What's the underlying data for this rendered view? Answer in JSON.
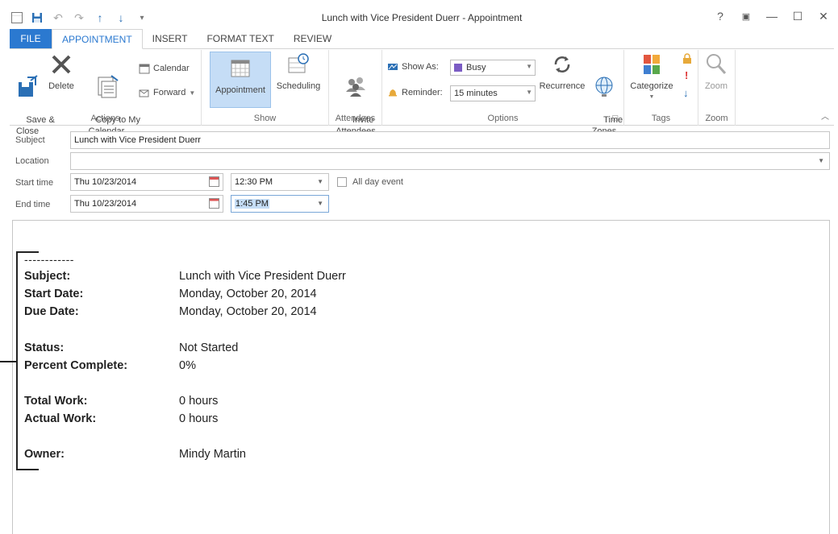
{
  "window": {
    "title": "Lunch with Vice President Duerr - Appointment",
    "help": "?",
    "ribbon_options": "▣",
    "minimize": "—",
    "maximize": "☐",
    "close": "✕"
  },
  "qat": {
    "app_icon": "calendar-icon",
    "save": "save-icon",
    "undo": "undo-icon",
    "redo": "redo-icon",
    "up": "↑",
    "down": "↓",
    "more": "▾"
  },
  "tabs": [
    "FILE",
    "APPOINTMENT",
    "INSERT",
    "FORMAT TEXT",
    "REVIEW"
  ],
  "ribbon": {
    "actions": {
      "label": "Actions",
      "save_close": "Save &\nClose",
      "delete": "Delete",
      "copy_to_calendar": "Copy to My\nCalendar",
      "calendar": "Calendar",
      "forward": "Forward"
    },
    "show": {
      "label": "Show",
      "appointment": "Appointment",
      "scheduling": "Scheduling"
    },
    "attendees": {
      "label": "Attendees",
      "invite": "Invite\nAttendees"
    },
    "options": {
      "label": "Options",
      "show_as_label": "Show As:",
      "show_as_value": "Busy",
      "reminder_label": "Reminder:",
      "reminder_value": "15 minutes",
      "recurrence": "Recurrence",
      "time_zones": "Time\nZones"
    },
    "tags": {
      "label": "Tags",
      "categorize": "Categorize"
    },
    "zoom": {
      "label": "Zoom",
      "zoom": "Zoom"
    }
  },
  "form": {
    "subject_label": "Subject",
    "subject_value": "Lunch with Vice President Duerr",
    "location_label": "Location",
    "location_value": "",
    "start_label": "Start time",
    "start_date": "Thu 10/23/2014",
    "start_time": "12:30 PM",
    "all_day": "All day event",
    "end_label": "End time",
    "end_date": "Thu 10/23/2014",
    "end_time": "1:45 PM"
  },
  "body": {
    "divider": "------------",
    "rows": [
      {
        "k": "Subject:",
        "v": "Lunch with Vice President Duerr"
      },
      {
        "k": "Start Date:",
        "v": "Monday, October 20, 2014"
      },
      {
        "k": "Due Date:",
        "v": "Monday, October 20, 2014"
      },
      {
        "k": "Status:",
        "v": "Not Started"
      },
      {
        "k": "Percent Complete:",
        "v": "0%"
      },
      {
        "k": "Total Work:",
        "v": "0 hours"
      },
      {
        "k": "Actual Work:",
        "v": "0 hours"
      },
      {
        "k": "Owner:",
        "v": "Mindy Martin"
      }
    ]
  },
  "colors": {
    "accent": "#2b79d0",
    "pressed": "#c5ddf6",
    "busy": "#7b5cc4"
  }
}
